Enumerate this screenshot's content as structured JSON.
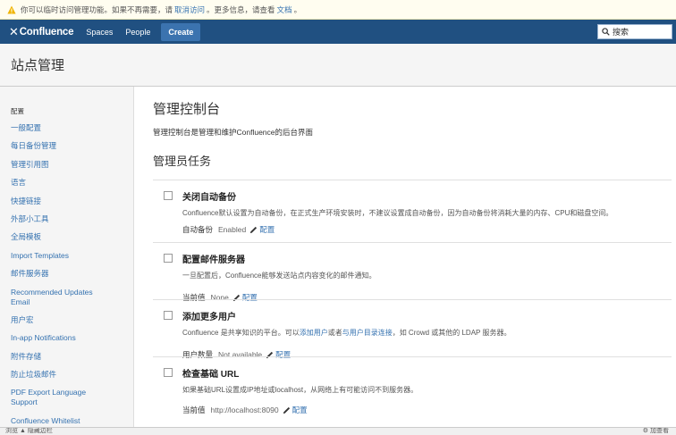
{
  "notice": {
    "text_before": "你可以临时访问管理功能。如果不再需要，请",
    "link_cancel": "取消访问",
    "text_middle": "。更多信息，请查看",
    "link_docs": "文档",
    "text_end": "。"
  },
  "topnav": {
    "logo": "Confluence",
    "spaces": "Spaces",
    "people": "People",
    "create": "Create",
    "search_placeholder": "搜索"
  },
  "page_title": "站点管理",
  "sidebar": {
    "heading": "配置",
    "items": [
      "一般配置",
      "每日备份管理",
      "管理引用图",
      "语言",
      "快捷链接",
      "外部小工具",
      "全局模板",
      "Import Templates",
      "邮件服务器",
      "Recommended Updates Email",
      "用户宏",
      "In-app Notifications",
      "附件存储",
      "防止垃圾邮件",
      "PDF Export Language Support",
      "Confluence Whitelist"
    ]
  },
  "main": {
    "title": "管理控制台",
    "description": "管理控制台是管理和维护Confluence的后台界面",
    "tasks_heading": "管理员任务",
    "tasks": [
      {
        "title": "关闭自动备份",
        "text": "Confluence默认设置为自动备份，在正式生产环境安装时，不建议设置成自动备份，因为自动备份将消耗大量的内存、CPU和磁盘空间。",
        "meta_label": "自动备份",
        "meta_value": "Enabled",
        "config": "配置"
      },
      {
        "title": "配置邮件服务器",
        "text": "一旦配置后，Confluence能够发送站点内容变化的邮件通知。",
        "meta_label": "当前值",
        "meta_value": "None",
        "config": "配置"
      },
      {
        "title": "添加更多用户",
        "text_a": "Confluence 是共享知识的平台。可以",
        "link_add": "添加用户",
        "text_b": "或者",
        "link_dir": "与用户目录连接",
        "text_c": "，如 Crowd 或其他的 LDAP 服务器。",
        "meta_label": "用户数量",
        "meta_value": "Not available",
        "config": "配置"
      },
      {
        "title": "检查基础 URL",
        "text": "如果基础URL设置成IP地址或localhost，从网络上有可能访问不到服务器。",
        "meta_label": "当前值",
        "meta_value": "http://localhost:8090",
        "config": "配置"
      }
    ]
  },
  "bottombar": {
    "left": "浏览   ▲ 隐藏边栏",
    "right": "⚙ 加查看"
  },
  "colors": {
    "nav_bg": "#205081",
    "create_bg": "#3b73af",
    "link": "#3572b0"
  }
}
